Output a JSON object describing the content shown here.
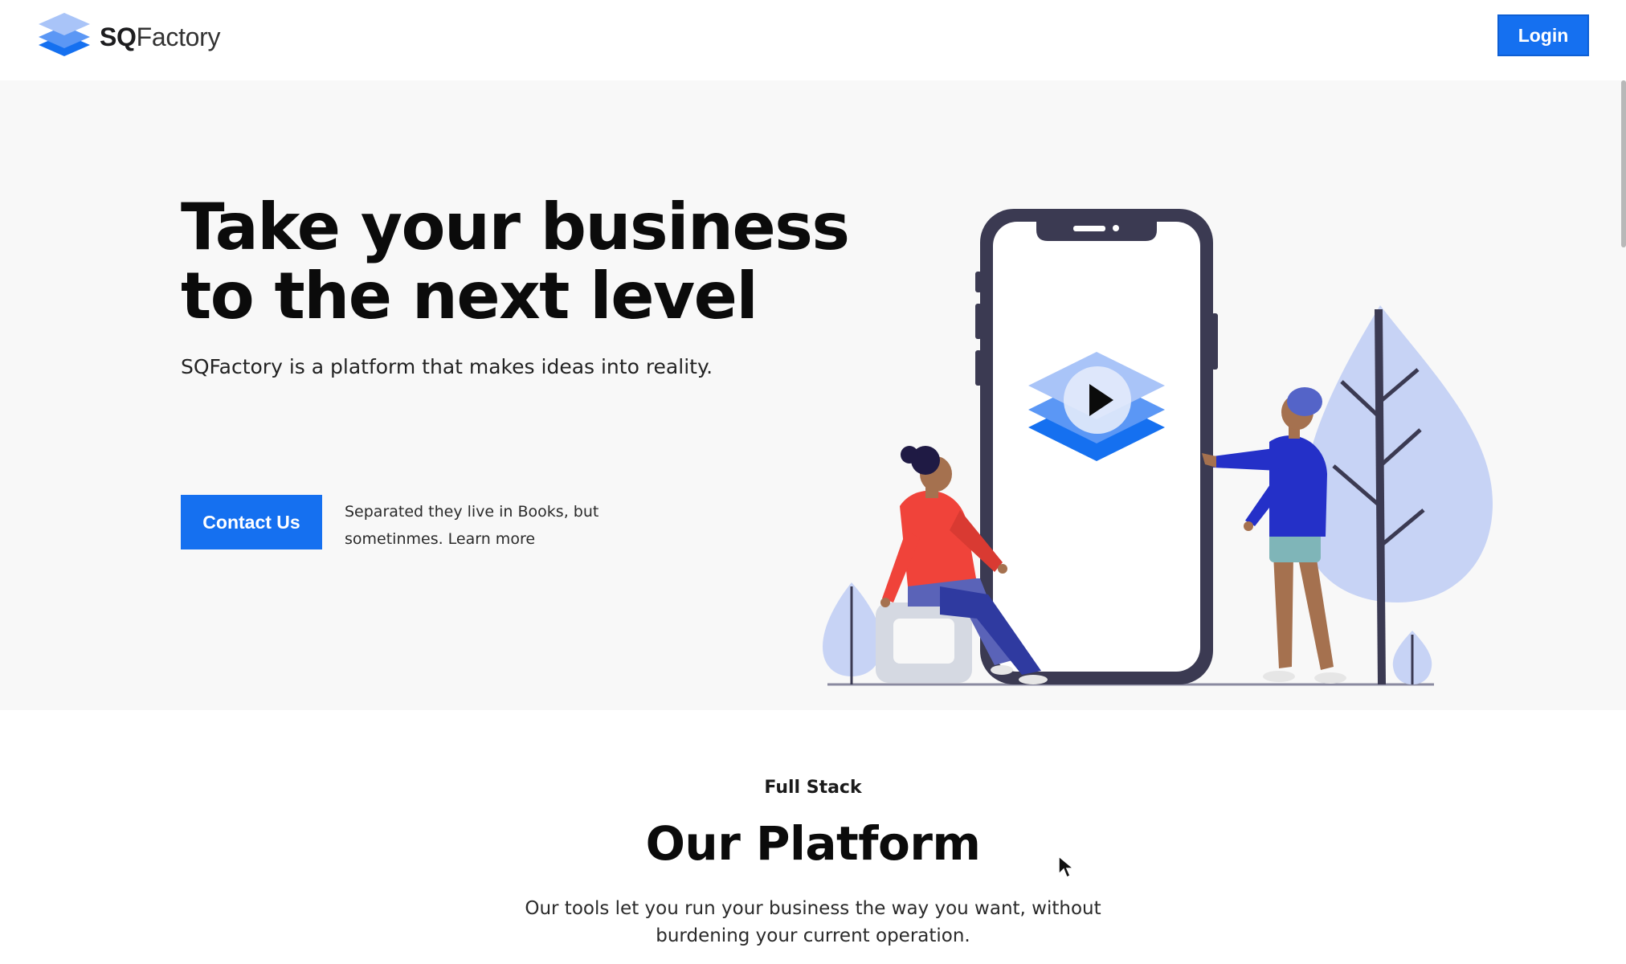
{
  "navbar": {
    "brand_bold": "SQ",
    "brand_rest": "Factory",
    "login_label": "Login",
    "accent": "#1570f0"
  },
  "hero": {
    "headline_line1": "Take your business",
    "headline_line2": "to the next level",
    "subtitle": "SQFactory is a platform that makes ideas into reality.",
    "contact_label": "Contact Us",
    "note_line1": "Separated they live in Books, but",
    "note_line2": "sometinmes. Learn more",
    "background": "#f8f8f8"
  },
  "illustration": {
    "icon": "video-play-icon",
    "description_colors": {
      "phone": "#3b3a52",
      "tree": "#c7d3f5",
      "play_layers": [
        "#a9c4f8",
        "#5b97f5",
        "#1570f0"
      ]
    }
  },
  "platform": {
    "eyebrow": "Full Stack",
    "title": "Our Platform",
    "desc_line1": "Our tools let you run your business the way you want, without",
    "desc_line2": "burdening your current operation."
  }
}
